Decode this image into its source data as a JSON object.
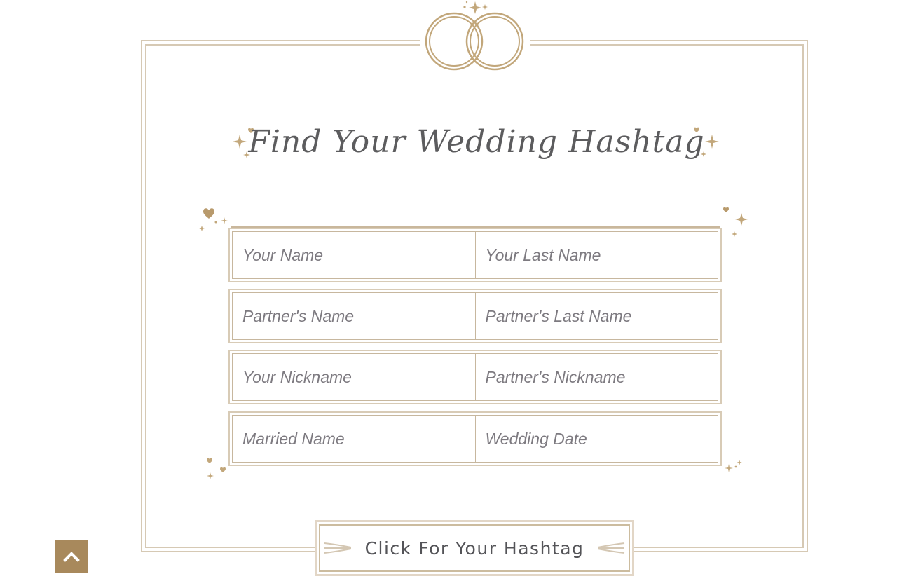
{
  "title": "Find Your Wedding Hashtag",
  "colors": {
    "gold": "#b89a6c",
    "frame": "#d6c9b4",
    "text": "#5c5c5e",
    "placeholder": "#7d7a80",
    "back_to_top_bg": "#a8895c"
  },
  "form": {
    "rows": [
      {
        "left": {
          "placeholder": "Your Name"
        },
        "right": {
          "placeholder": "Your Last Name"
        }
      },
      {
        "left": {
          "placeholder": "Partner's Name"
        },
        "right": {
          "placeholder": "Partner's Last Name"
        }
      },
      {
        "left": {
          "placeholder": "Your Nickname"
        },
        "right": {
          "placeholder": "Partner's Nickname"
        }
      },
      {
        "left": {
          "placeholder": "Married Name"
        },
        "right": {
          "placeholder": "Wedding Date"
        }
      }
    ]
  },
  "button": {
    "label": "Click For Your Hashtag"
  },
  "icons": {
    "emblem": "wedding-rings-icon",
    "back_to_top": "chevron-up-icon",
    "decor": "sparkle-icon"
  }
}
